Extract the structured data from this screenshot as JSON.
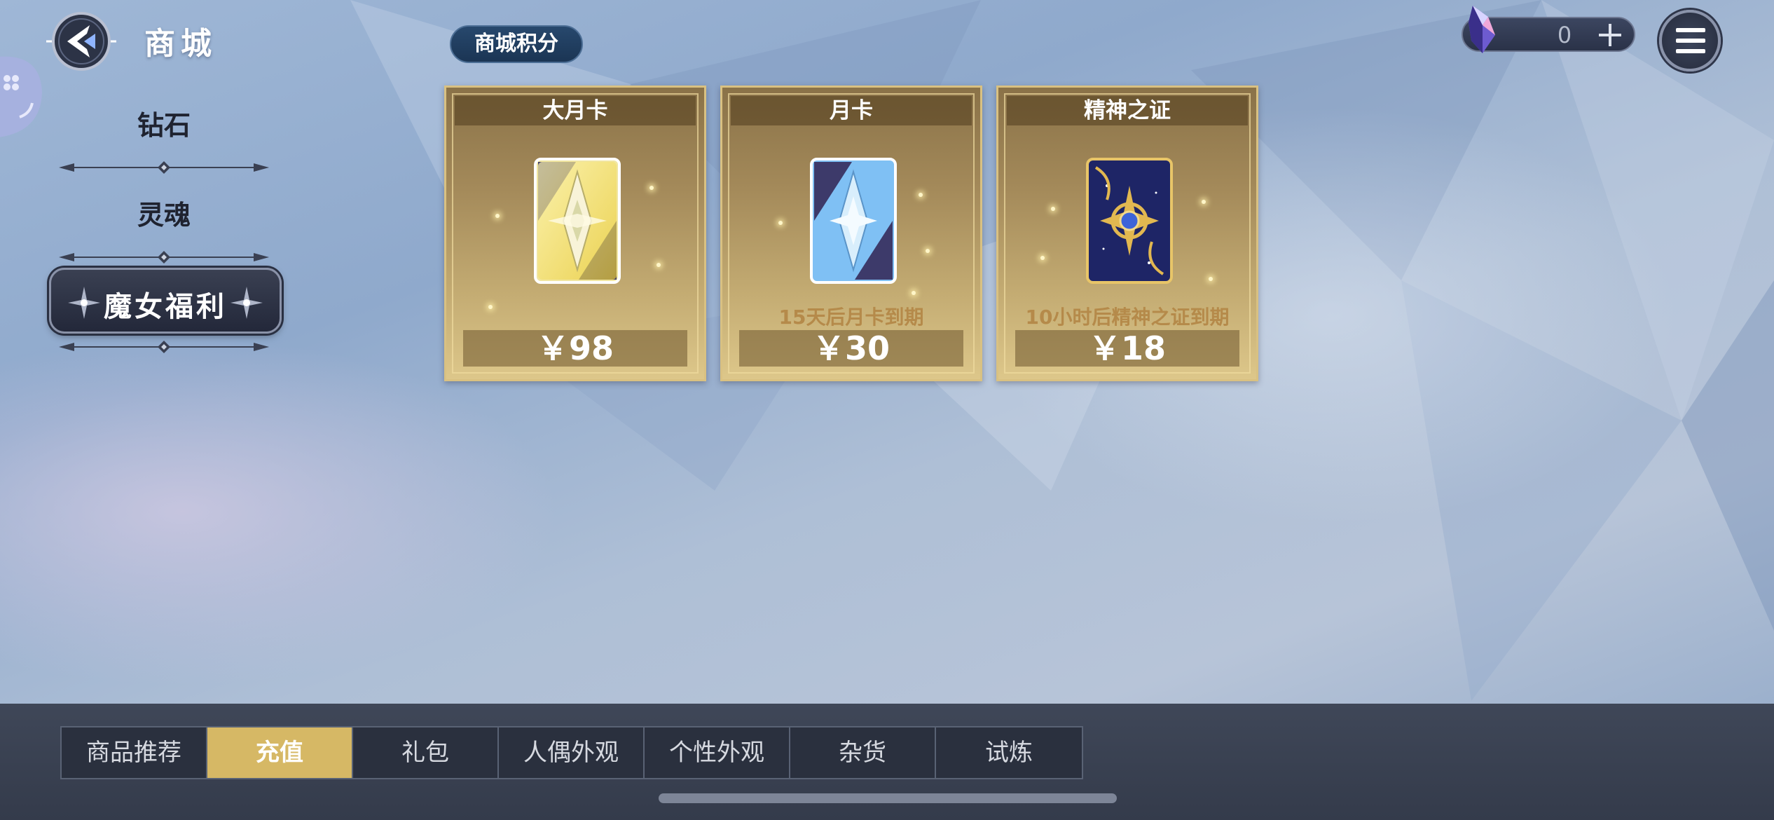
{
  "header": {
    "title": "商城",
    "back_icon": "back-arrow-icon"
  },
  "nav": {
    "items": [
      {
        "label": "钻石"
      },
      {
        "label": "灵魂"
      },
      {
        "label": "魔女福利",
        "active": true
      }
    ]
  },
  "points_badge": "商城积分",
  "currency": {
    "value": "0",
    "icon": "crystal-gem-icon",
    "plus_icon": "plus-icon"
  },
  "menu_icon": "hamburger-menu-icon",
  "cards": [
    {
      "title": "大月卡",
      "note": "",
      "price": "￥98",
      "theme": "gold"
    },
    {
      "title": "月卡",
      "note": "15天后月卡到期",
      "price": "￥30",
      "theme": "blue"
    },
    {
      "title": "精神之证",
      "note": "10小时后精神之证到期",
      "price": "￥18",
      "theme": "night"
    }
  ],
  "tabs": [
    {
      "label": "商品推荐",
      "active": false
    },
    {
      "label": "充值",
      "active": true
    },
    {
      "label": "礼包",
      "active": false
    },
    {
      "label": "人偶外观",
      "active": false
    },
    {
      "label": "个性外观",
      "active": false
    },
    {
      "label": "杂货",
      "active": false
    },
    {
      "label": "试炼",
      "active": false
    }
  ],
  "colors": {
    "accent_gold": "#d6b865",
    "card_note": "#b58a4a",
    "points_badge": "#1f3b5e",
    "bottom_bar": "#3a4252"
  }
}
